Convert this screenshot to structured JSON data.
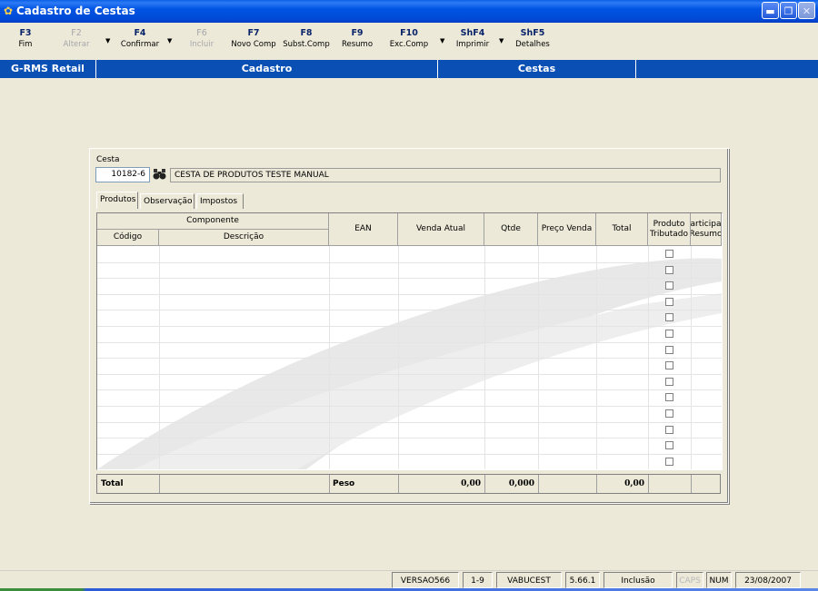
{
  "window": {
    "title": "Cadastro de Cestas",
    "app_icon": "leaf-icon"
  },
  "toolbar": {
    "keys": [
      {
        "key": "F3",
        "label": "Fim",
        "enabled": true
      },
      {
        "key": "F2",
        "label": "Alterar",
        "enabled": false
      },
      {
        "key": "F4",
        "label": "Confirmar",
        "enabled": true
      },
      {
        "key": "F6",
        "label": "Incluir",
        "enabled": false
      },
      {
        "key": "F7",
        "label": "Novo Comp",
        "enabled": true
      },
      {
        "key": "F8",
        "label": "Subst.Comp",
        "enabled": true
      },
      {
        "key": "F9",
        "label": "Resumo",
        "enabled": true
      },
      {
        "key": "F10",
        "label": "Exc.Comp",
        "enabled": true
      },
      {
        "key": "ShF4",
        "label": "Imprimir",
        "enabled": true
      },
      {
        "key": "ShF5",
        "label": "Detalhes",
        "enabled": true
      }
    ]
  },
  "header_strip": {
    "system": "G-RMS Retail",
    "module": "Cadastro",
    "entity": "Cestas"
  },
  "form": {
    "cesta_label": "Cesta",
    "cesta_code": "10182-6",
    "cesta_description": "CESTA DE PRODUTOS TESTE MANUAL"
  },
  "tabs": [
    "Produtos",
    "Observação",
    "Impostos"
  ],
  "grid": {
    "group_header": "Componente",
    "columns": {
      "codigo": "Código",
      "descricao": "Descrição",
      "ean": "EAN",
      "venda_atual": "Venda Atual",
      "qtde": "Qtde",
      "preco_venda": "Preço Venda",
      "total": "Total",
      "produto_tributado_1": "Produto",
      "produto_tributado_2": "Tributado",
      "participa_1": "articipa",
      "participa_2": "Resumo"
    }
  },
  "totals": {
    "total_label": "Total",
    "peso_label": "Peso",
    "venda_atual": "0,00",
    "qtde": "0,000",
    "total": "0,00"
  },
  "statusbar": {
    "version": "VERSAO566",
    "page": "1-9",
    "program": "VABUCEST",
    "build": "5.66.1",
    "mode": "Inclusão",
    "caps": "CAPS",
    "num": "NUM",
    "date": "23/08/2007"
  },
  "colors": {
    "title_bar": "#0054E3",
    "strip": "#0A50B4",
    "background": "#ECE9D8"
  }
}
